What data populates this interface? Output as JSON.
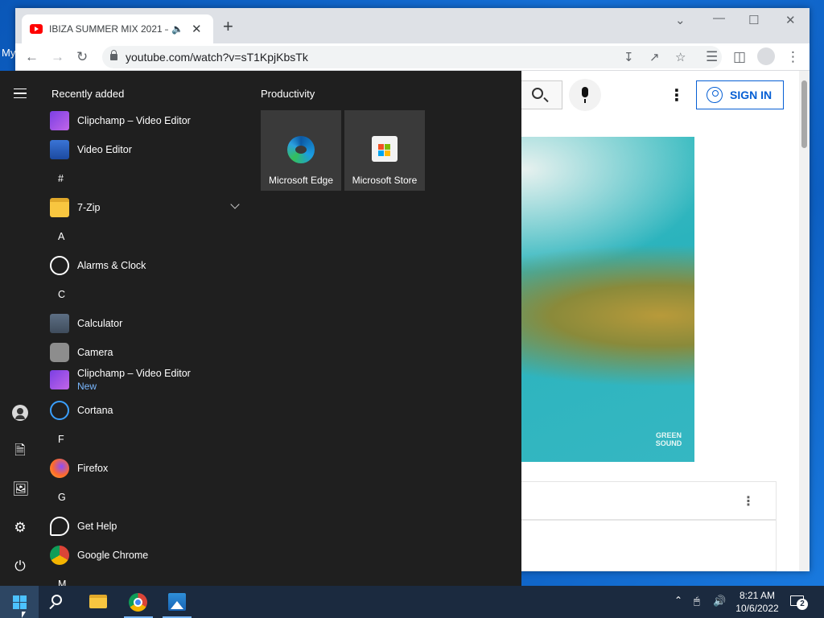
{
  "desktop": {
    "label": "My"
  },
  "browser": {
    "tab_title": "IBIZA SUMMER MIX 2021 –",
    "url": "youtube.com/watch?v=sT1KpjKbsTk"
  },
  "youtube": {
    "sign_in": "SIGN IN",
    "watermark": "GREEN SOUND"
  },
  "start_menu": {
    "recently_added_heading": "Recently added",
    "recent": [
      {
        "label": "Clipchamp – Video Editor",
        "icon": "clipchamp-icon"
      },
      {
        "label": "Video Editor",
        "icon": "video-editor-icon"
      }
    ],
    "sections": [
      {
        "letter": "#",
        "apps": [
          {
            "label": "7-Zip",
            "icon": "folder-icon",
            "expandable": true
          }
        ]
      },
      {
        "letter": "A",
        "apps": [
          {
            "label": "Alarms & Clock",
            "icon": "alarm-clock-icon"
          }
        ]
      },
      {
        "letter": "C",
        "apps": [
          {
            "label": "Calculator",
            "icon": "calculator-icon"
          },
          {
            "label": "Camera",
            "icon": "camera-icon"
          },
          {
            "label": "Clipchamp – Video Editor",
            "sub": "New",
            "icon": "clipchamp-icon"
          },
          {
            "label": "Cortana",
            "icon": "cortana-icon"
          }
        ]
      },
      {
        "letter": "F",
        "apps": [
          {
            "label": "Firefox",
            "icon": "firefox-icon"
          }
        ]
      },
      {
        "letter": "G",
        "apps": [
          {
            "label": "Get Help",
            "icon": "get-help-icon"
          },
          {
            "label": "Google Chrome",
            "icon": "chrome-icon"
          }
        ]
      },
      {
        "letter": "M",
        "apps": []
      }
    ],
    "tiles_heading": "Productivity",
    "tiles": [
      {
        "label": "Microsoft Edge",
        "icon": "edge-icon"
      },
      {
        "label": "Microsoft Store",
        "icon": "store-icon"
      }
    ]
  },
  "taskbar": {
    "time": "8:21 AM",
    "date": "10/6/2022",
    "notification_count": "2"
  }
}
